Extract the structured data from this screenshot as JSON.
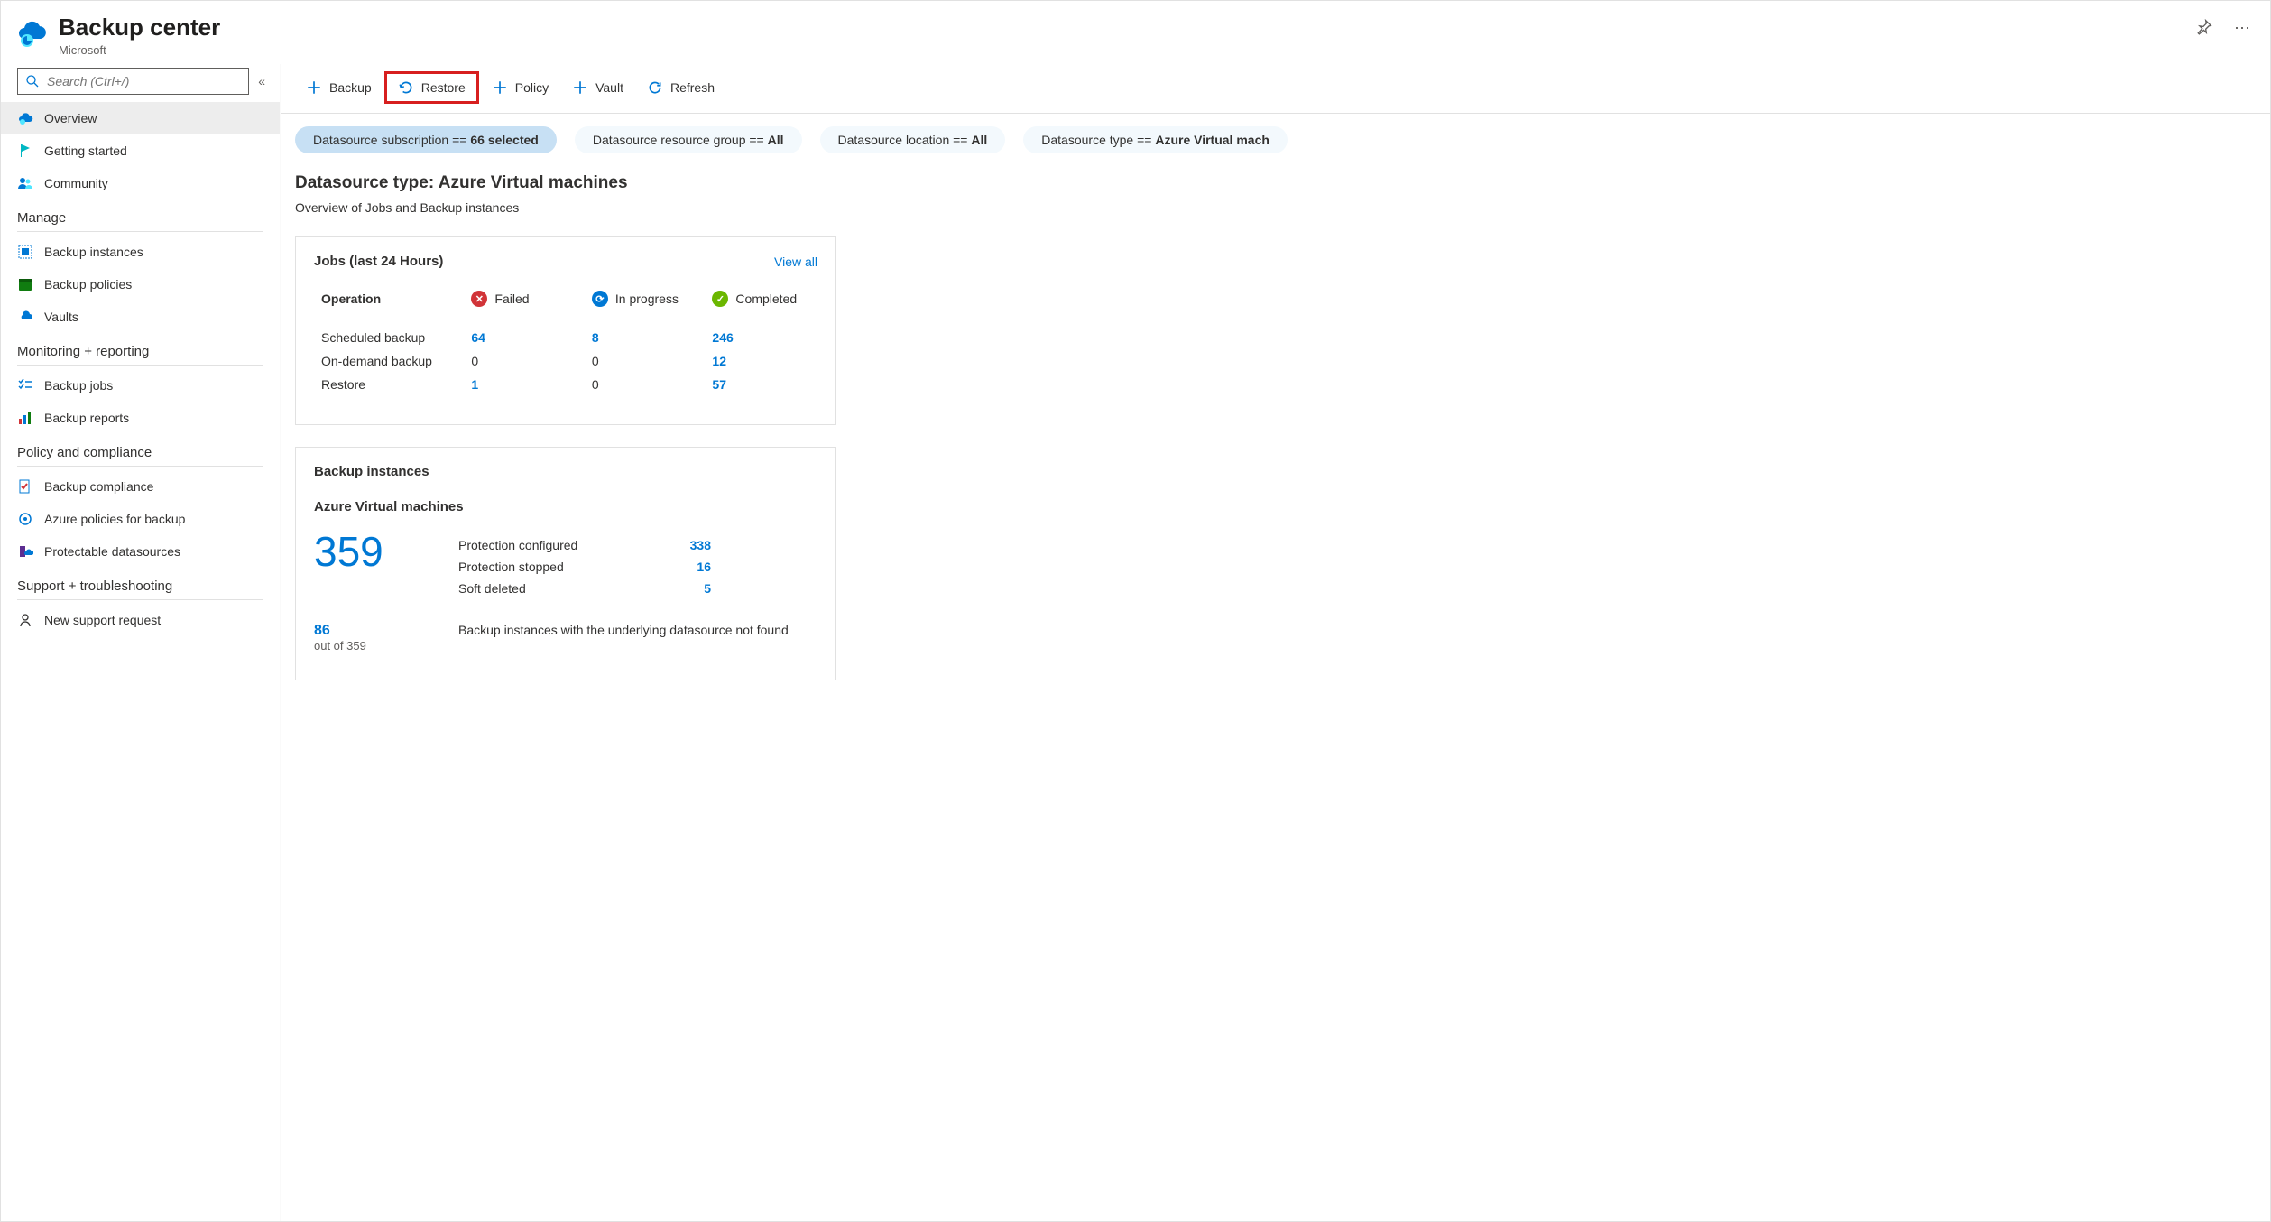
{
  "header": {
    "title": "Backup center",
    "subtitle": "Microsoft"
  },
  "search": {
    "placeholder": "Search (Ctrl+/)"
  },
  "sidebar": {
    "items": [
      {
        "label": "Overview",
        "icon": "cloud-backup",
        "active": true
      },
      {
        "label": "Getting started",
        "icon": "flag"
      },
      {
        "label": "Community",
        "icon": "people"
      }
    ],
    "sections": [
      {
        "title": "Manage",
        "items": [
          {
            "label": "Backup instances",
            "icon": "grid-blue"
          },
          {
            "label": "Backup policies",
            "icon": "calendar-green"
          },
          {
            "label": "Vaults",
            "icon": "vault-cloud"
          }
        ]
      },
      {
        "title": "Monitoring + reporting",
        "items": [
          {
            "label": "Backup jobs",
            "icon": "checklist"
          },
          {
            "label": "Backup reports",
            "icon": "bar-chart"
          }
        ]
      },
      {
        "title": "Policy and compliance",
        "items": [
          {
            "label": "Backup compliance",
            "icon": "doc-check"
          },
          {
            "label": "Azure policies for backup",
            "icon": "policy-gear"
          },
          {
            "label": "Protectable datasources",
            "icon": "server-cloud"
          }
        ]
      },
      {
        "title": "Support + troubleshooting",
        "items": [
          {
            "label": "New support request",
            "icon": "support"
          }
        ]
      }
    ]
  },
  "toolbar": {
    "backup": "Backup",
    "restore": "Restore",
    "policy": "Policy",
    "vault": "Vault",
    "refresh": "Refresh"
  },
  "filters": [
    {
      "label": "Datasource subscription == ",
      "value": "66 selected",
      "active": true
    },
    {
      "label": "Datasource resource group == ",
      "value": "All"
    },
    {
      "label": "Datasource location == ",
      "value": "All"
    },
    {
      "label": "Datasource type == ",
      "value": "Azure Virtual mach"
    }
  ],
  "main": {
    "title": "Datasource type: Azure Virtual machines",
    "subtitle": "Overview of Jobs and Backup instances"
  },
  "jobs_card": {
    "title": "Jobs (last 24 Hours)",
    "view_all": "View all",
    "col_operation": "Operation",
    "col_failed": "Failed",
    "col_inprogress": "In progress",
    "col_completed": "Completed",
    "rows": [
      {
        "op": "Scheduled backup",
        "failed": "64",
        "failed_link": true,
        "inprogress": "8",
        "inprogress_link": true,
        "completed": "246",
        "completed_link": true
      },
      {
        "op": "On-demand backup",
        "failed": "0",
        "failed_link": false,
        "inprogress": "0",
        "inprogress_link": false,
        "completed": "12",
        "completed_link": true
      },
      {
        "op": "Restore",
        "failed": "1",
        "failed_link": true,
        "inprogress": "0",
        "inprogress_link": false,
        "completed": "57",
        "completed_link": true
      }
    ]
  },
  "instances_card": {
    "title": "Backup instances",
    "subtitle": "Azure Virtual machines",
    "total": "359",
    "stats": [
      {
        "label": "Protection configured",
        "value": "338"
      },
      {
        "label": "Protection stopped",
        "value": "16"
      },
      {
        "label": "Soft deleted",
        "value": "5"
      }
    ],
    "not_found_count": "86",
    "not_found_of": "out of 359",
    "not_found_desc": "Backup instances with the underlying datasource not found"
  }
}
